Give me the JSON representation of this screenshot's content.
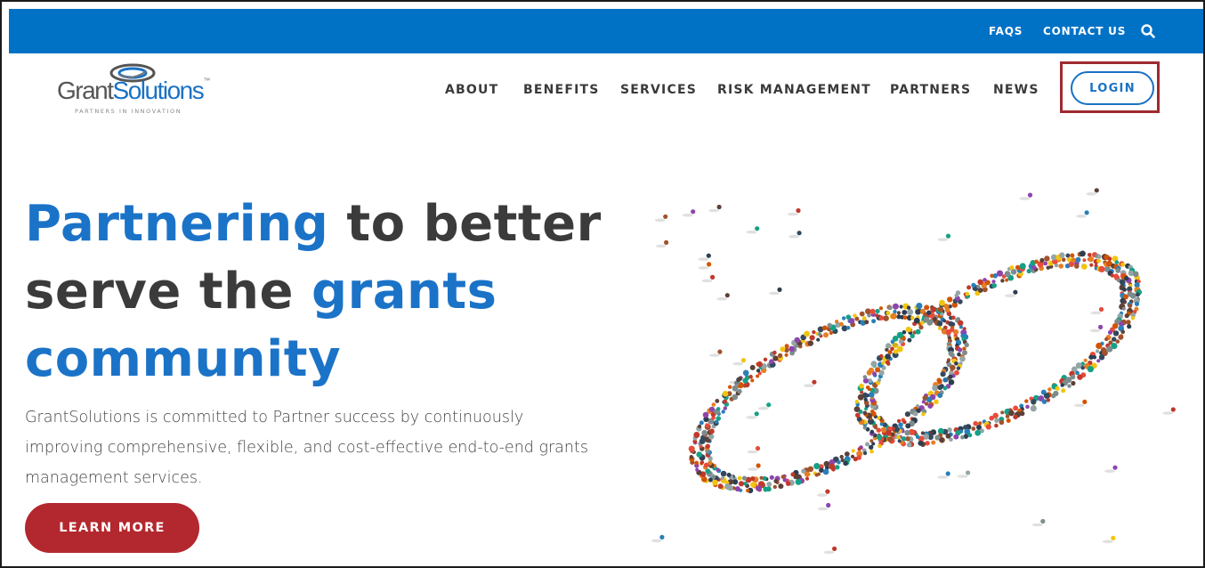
{
  "topbar": {
    "faqs_label": "FAQS",
    "contact_label": "CONTACT US",
    "search_icon": "search-icon",
    "background_color": "#0072c6"
  },
  "logo": {
    "word_grant": "Grant",
    "word_solutions": "Solutions",
    "tagline": "PARTNERS IN INNOVATION"
  },
  "nav": {
    "items": [
      "ABOUT",
      "BENEFITS",
      "SERVICES",
      "RISK MANAGEMENT",
      "PARTNERS",
      "NEWS"
    ],
    "login_label": "LOGIN"
  },
  "hero": {
    "title_part1": "Partnering",
    "title_part2": " to better serve the ",
    "title_part3": "grants community",
    "description": "GrantSolutions is committed to Partner success by continuously improving comprehensive, flexible, and cost-effective end-to-end grants management services.",
    "cta_label": "LEARN MORE"
  },
  "colors": {
    "accent_blue": "#1b73c8",
    "cta_red": "#b3282e",
    "highlight_red": "#9e2a2f"
  }
}
